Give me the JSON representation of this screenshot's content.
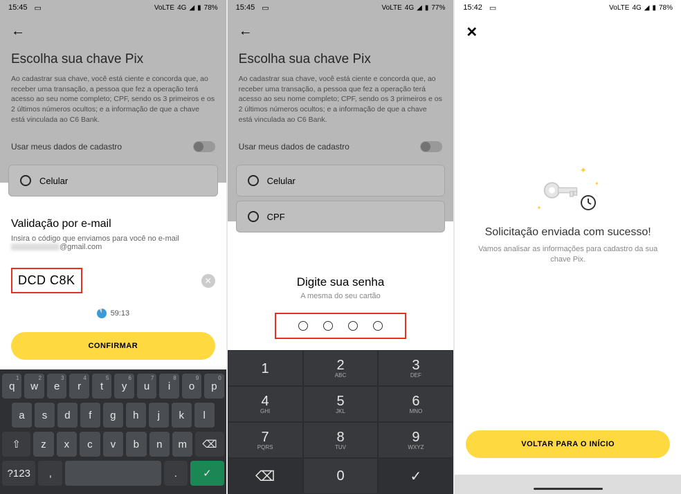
{
  "phone1": {
    "status": {
      "time": "15:45",
      "network": "4G",
      "battery": "78%",
      "lte": "VoLTE"
    },
    "bg": {
      "title": "Escolha sua chave Pix",
      "desc": "Ao cadastrar sua chave, você está ciente e concorda que, ao receber uma transação, a pessoa que fez a operação terá acesso ao seu nome completo; CPF, sendo os 3 primeiros e os 2 últimos números ocultos; e a informação de que a chave está vinculada ao C6 Bank.",
      "toggle_label": "Usar meus dados de cadastro",
      "option_celular": "Celular"
    },
    "sheet": {
      "title": "Validação por e-mail",
      "sub": "Insira o código que enviamos para você no e-mail",
      "email_suffix": "@gmail.com",
      "code_value": "DCD C8K",
      "timer": "59:13",
      "confirm_btn": "CONFIRMAR"
    },
    "keyboard": {
      "row1": [
        "q",
        "w",
        "e",
        "r",
        "t",
        "y",
        "u",
        "i",
        "o",
        "p"
      ],
      "row1_nums": [
        "1",
        "2",
        "3",
        "4",
        "5",
        "6",
        "7",
        "8",
        "9",
        "0"
      ],
      "row2": [
        "a",
        "s",
        "d",
        "f",
        "g",
        "h",
        "j",
        "k",
        "l"
      ],
      "row3": [
        "z",
        "x",
        "c",
        "v",
        "b",
        "n",
        "m"
      ],
      "shift": "⇧",
      "backspace": "⌫",
      "sym": "?123",
      "comma": ",",
      "period": ".",
      "submit": "✓"
    }
  },
  "phone2": {
    "status": {
      "time": "15:45",
      "network": "4G",
      "battery": "77%",
      "lte": "VoLTE"
    },
    "bg": {
      "title": "Escolha sua chave Pix",
      "desc": "Ao cadastrar sua chave, você está ciente e concorda que, ao receber uma transação, a pessoa que fez a operação terá acesso ao seu nome completo; CPF, sendo os 3 primeiros e os 2 últimos números ocultos; e a informação de que a chave está vinculada ao C6 Bank.",
      "toggle_label": "Usar meus dados de cadastro",
      "option_celular": "Celular",
      "option_cpf": "CPF"
    },
    "sheet": {
      "title": "Digite sua senha",
      "sub": "A mesma do seu cartão"
    },
    "numpad": {
      "keys": [
        {
          "n": "1",
          "l": ""
        },
        {
          "n": "2",
          "l": "ABC"
        },
        {
          "n": "3",
          "l": "DEF"
        },
        {
          "n": "4",
          "l": "GHI"
        },
        {
          "n": "5",
          "l": "JKL"
        },
        {
          "n": "6",
          "l": "MNO"
        },
        {
          "n": "7",
          "l": "PQRS"
        },
        {
          "n": "8",
          "l": "TUV"
        },
        {
          "n": "9",
          "l": "WXYZ"
        }
      ],
      "backspace": "⌫",
      "zero": "0",
      "submit": "✓"
    }
  },
  "phone3": {
    "status": {
      "time": "15:42",
      "network": "4G",
      "battery": "78%",
      "lte": "VoLTE"
    },
    "success": {
      "title": "Solicitação enviada com sucesso!",
      "sub": "Vamos analisar as informações para cadastro da sua chave Pix.",
      "button": "VOLTAR PARA O INÍCIO"
    }
  }
}
